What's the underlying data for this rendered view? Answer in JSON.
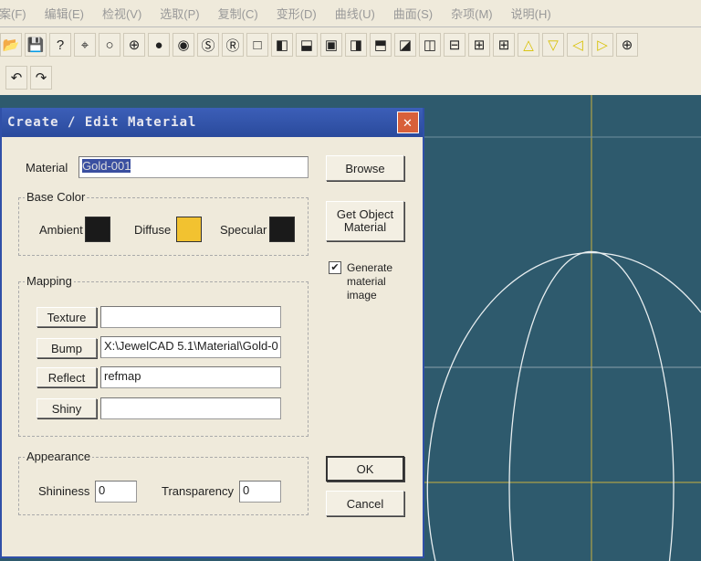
{
  "menu": [
    "档案(F)",
    "编辑(E)",
    "检视(V)",
    "选取(P)",
    "复制(C)",
    "变形(D)",
    "曲线(U)",
    "曲面(S)",
    "杂项(M)",
    "说明(H)"
  ],
  "toolbar_icons": [
    "open-icon",
    "save-icon",
    "help-icon",
    "point-icon",
    "circle-icon",
    "sphere-grid-icon",
    "sphere-dark-icon",
    "sphere-gray-icon",
    "sphere-s-icon",
    "sphere-r-icon",
    "view1-icon",
    "view2-icon",
    "view3-icon",
    "view4-icon",
    "view5-icon",
    "view6-icon",
    "view7-icon",
    "split-v-icon",
    "split-h-icon",
    "quad-icon",
    "quad2-icon",
    "arrow-up-icon",
    "arrow-down-icon",
    "arrow-left-icon",
    "arrow-right-icon",
    "zoom-in-icon"
  ],
  "dialog": {
    "title": "Create / Edit Material",
    "material_label": "Material",
    "material_value": "Gold-001",
    "browse": "Browse",
    "get_object": "Get Object Material",
    "base_color": "Base Color",
    "ambient": "Ambient",
    "diffuse": "Diffuse",
    "specular": "Specular",
    "colors": {
      "ambient": "#1a1a1a",
      "diffuse": "#f2c230",
      "specular": "#1a1a1a"
    },
    "generate": "Generate material image",
    "generate_checked": true,
    "mapping": "Mapping",
    "texture": "Texture",
    "texture_value": "",
    "bump": "Bump",
    "bump_value": "X:\\JewelCAD 5.1\\Material\\Gold-0",
    "reflect": "Reflect",
    "reflect_value": "refmap",
    "shiny": "Shiny",
    "shiny_value": "",
    "appearance": "Appearance",
    "shininess": "Shininess",
    "shininess_value": "0",
    "transparency": "Transparency",
    "transparency_value": "0",
    "ok": "OK",
    "cancel": "Cancel"
  }
}
